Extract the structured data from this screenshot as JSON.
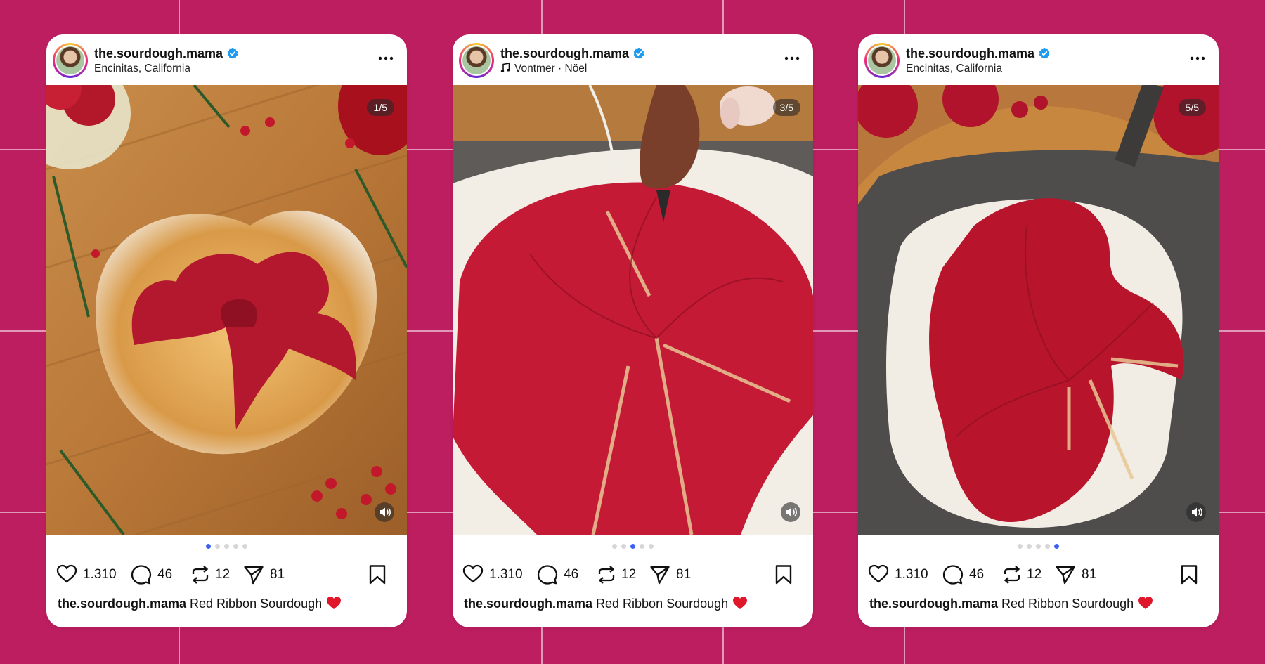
{
  "colors": {
    "background": "#bd1e60",
    "card": "#ffffff",
    "verified": "#1d9bf0",
    "active_dot": "#3e61f4",
    "caption_heart": "#e0162b"
  },
  "posts": [
    {
      "username": "the.sourdough.mama",
      "verified_icon": "verified-badge-icon",
      "subline": "Encinitas, California",
      "subline_icon": "",
      "more_icon": "more-horizontal-icon",
      "slide_counter": "1/5",
      "slide_index": 1,
      "slide_total": 5,
      "mute_icon": "volume-icon",
      "image_description_icon": "bread-photo",
      "likes": "1.310",
      "comments": "46",
      "reposts": "12",
      "shares": "81",
      "caption_user": "the.sourdough.mama",
      "caption_text": "Red Ribbon Sourdough"
    },
    {
      "username": "the.sourdough.mama",
      "verified_icon": "verified-badge-icon",
      "subline": "Vontmer · Nöel",
      "subline_icon": "music-note-icon",
      "more_icon": "more-horizontal-icon",
      "slide_counter": "3/5",
      "slide_index": 3,
      "slide_total": 5,
      "mute_icon": "volume-icon",
      "image_description_icon": "bread-photo",
      "likes": "1.310",
      "comments": "46",
      "reposts": "12",
      "shares": "81",
      "caption_user": "the.sourdough.mama",
      "caption_text": "Red Ribbon Sourdough"
    },
    {
      "username": "the.sourdough.mama",
      "verified_icon": "verified-badge-icon",
      "subline": "Encinitas, California",
      "subline_icon": "",
      "more_icon": "more-horizontal-icon",
      "slide_counter": "5/5",
      "slide_index": 5,
      "slide_total": 5,
      "mute_icon": "volume-icon",
      "image_description_icon": "bread-photo",
      "likes": "1.310",
      "comments": "46",
      "reposts": "12",
      "shares": "81",
      "caption_user": "the.sourdough.mama",
      "caption_text": "Red Ribbon Sourdough"
    }
  ]
}
